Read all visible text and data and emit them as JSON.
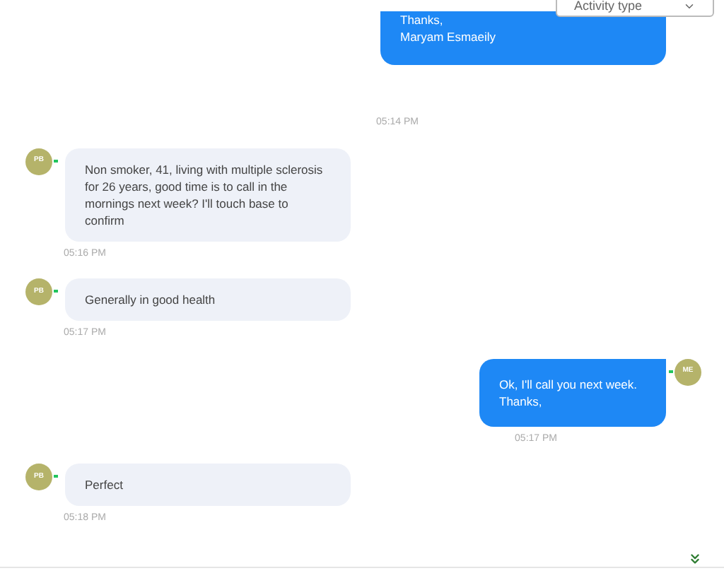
{
  "filter": {
    "placeholder": "Activity type"
  },
  "messages": [
    {
      "kind": "outgoing",
      "lines": [
        "Thanks,",
        "Maryam Esmaeily"
      ],
      "time": "05:14 PM"
    },
    {
      "kind": "incoming",
      "avatar": "PB",
      "lines": [
        "Non smoker, 41, living with multiple sclerosis for 26 years, good time is to call in the mornings next week? I'll touch base to confirm"
      ],
      "time": "05:16 PM"
    },
    {
      "kind": "incoming",
      "avatar": "PB",
      "lines": [
        "Generally in good health"
      ],
      "time": "05:17 PM"
    },
    {
      "kind": "outgoing",
      "avatar": "ME",
      "lines": [
        "Ok, I'll call you next week.",
        "Thanks,"
      ],
      "time": "05:17 PM"
    },
    {
      "kind": "incoming",
      "avatar": "PB",
      "lines": [
        "Perfect"
      ],
      "time": "05:18 PM"
    }
  ]
}
